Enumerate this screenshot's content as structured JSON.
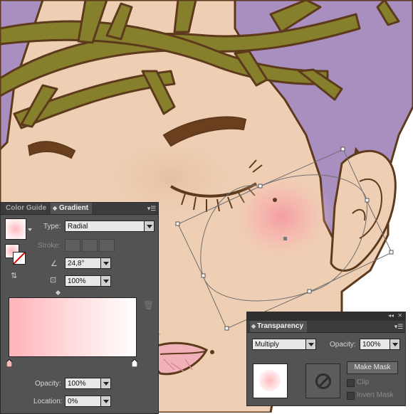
{
  "gradient_panel": {
    "tabs": [
      {
        "label": "Color Guide"
      },
      {
        "label": "Gradient"
      }
    ],
    "type_label": "Type:",
    "type_value": "Radial",
    "stroke_label": "Stroke:",
    "angle_value": "24,8°",
    "aspect_value": "100%",
    "opacity_label": "Opacity:",
    "opacity_value": "100%",
    "location_label": "Location:",
    "location_value": "0%"
  },
  "transparency_panel": {
    "tab_label": "Transparency",
    "blend_mode": "Multiply",
    "opacity_label": "Opacity:",
    "opacity_value": "100%",
    "make_mask_label": "Make Mask",
    "clip_label": "Clip",
    "invert_mask_label": "Invert Mask"
  },
  "colors": {
    "skin": "#efcfb4",
    "hair": "#a98ec0",
    "thorns": "#86802c",
    "outline": "#5e3a1c",
    "blush": "#f59a9e",
    "panel_bg": "#535353"
  },
  "icons": [
    "gradient-swatch-icon",
    "fill-stroke-icon",
    "reverse-gradient-icon",
    "angle-icon",
    "aspect-ratio-icon",
    "trash-icon",
    "no-mask-icon",
    "collapse-icon",
    "panel-menu-icon"
  ]
}
